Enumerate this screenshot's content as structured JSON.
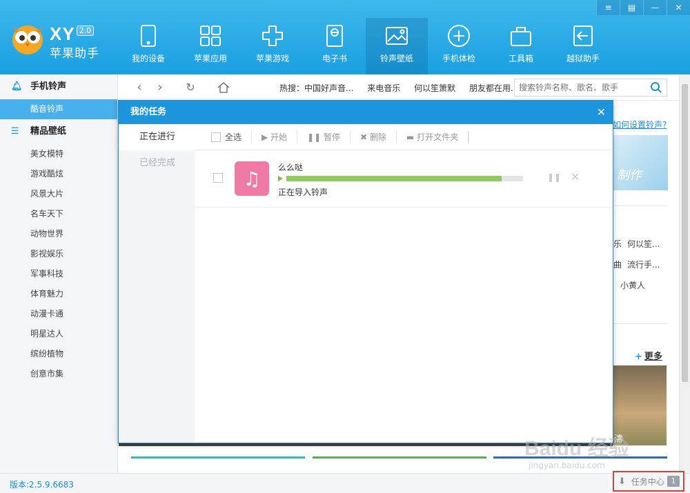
{
  "app": {
    "brand": "XY",
    "version_badge": "2.0",
    "name": "苹果助手"
  },
  "nav": [
    {
      "label": "我的设备",
      "icon": "tablet-icon"
    },
    {
      "label": "苹果应用",
      "icon": "apps-grid-icon"
    },
    {
      "label": "苹果游戏",
      "icon": "gamepad-icon"
    },
    {
      "label": "电子书",
      "icon": "ebook-icon"
    },
    {
      "label": "铃声壁纸",
      "icon": "picture-music-icon",
      "active": true
    },
    {
      "label": "手机体检",
      "icon": "plus-circle-icon"
    },
    {
      "label": "工具箱",
      "icon": "toolbox-icon"
    },
    {
      "label": "越狱助手",
      "icon": "jailbreak-exit-icon"
    }
  ],
  "window_controls": [
    "≡",
    "▤",
    "—",
    "✕"
  ],
  "sidebar": {
    "section1": "手机铃声",
    "section1_items": [
      {
        "label": "酷音铃声",
        "active": true
      }
    ],
    "section2": "精品壁纸",
    "section2_items": [
      {
        "label": "美女模特"
      },
      {
        "label": "游戏酷炫"
      },
      {
        "label": "风景大片"
      },
      {
        "label": "名车天下"
      },
      {
        "label": "动物世界"
      },
      {
        "label": "影视娱乐"
      },
      {
        "label": "军事科技"
      },
      {
        "label": "体育魅力"
      },
      {
        "label": "动漫卡通"
      },
      {
        "label": "明星达人"
      },
      {
        "label": "缤纷植物"
      },
      {
        "label": "创意市集"
      }
    ]
  },
  "toolbar": {
    "hot_prefix": "热搜：中国好声音...",
    "hot_items": [
      "来电音乐",
      "何以笙箫默",
      "朋友都在用..."
    ],
    "search_placeholder": "搜索铃声名称、歌名、歌手"
  },
  "background": {
    "howto_link": "如何设置铃声?",
    "banner1_text": "制作",
    "hotlist": [
      "乐",
      "何以笙...",
      "曲",
      "流行手...",
      "小黄人"
    ],
    "more_label": "更多",
    "banner2_text": "濤"
  },
  "modal": {
    "title": "我的任务",
    "close": "✕",
    "tabs": [
      {
        "label": "正在进行",
        "active": true
      },
      {
        "label": "已经完成"
      }
    ],
    "tools": {
      "select_all": "全选",
      "start": "▶ 开始",
      "pause": "❚❚ 暂停",
      "delete": "✖ 删除",
      "open_folder": "打开文件夹"
    },
    "tasks": [
      {
        "name": "么么哒",
        "progress": 0.91,
        "status": "正在导入铃声"
      }
    ]
  },
  "statusbar": {
    "version": "版本:2.5.9.6683",
    "task_center": "任务中心",
    "task_count": "1"
  },
  "watermark": {
    "main": "Baidu 经验",
    "sub": "jingyan.baidu.com"
  },
  "colors": {
    "header": "#1d9fe0",
    "accent": "#48b0ea",
    "progress": "#8ecb5a",
    "highlight": "#e53935"
  }
}
